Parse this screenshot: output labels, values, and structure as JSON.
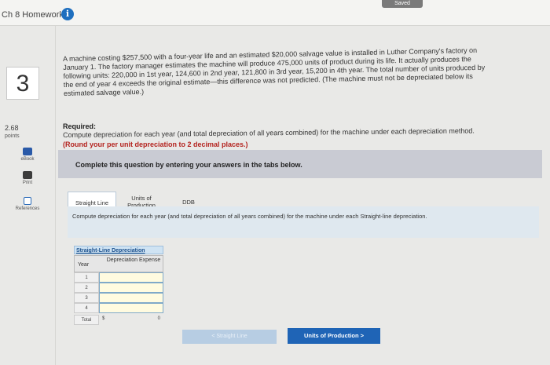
{
  "header": {
    "title": "Ch 8 Homework",
    "info_icon": "info-icon",
    "saved_label": "Saved"
  },
  "sidebar": {
    "question_number": "3",
    "points_value": "2.68",
    "points_label": "points",
    "tools": [
      {
        "label": "eBook",
        "icon": "ebook-icon"
      },
      {
        "label": "Print",
        "icon": "print-icon"
      },
      {
        "label": "References",
        "icon": "references-icon"
      }
    ]
  },
  "problem": {
    "line1": "A machine costing $257,500 with a four-year life and an estimated $20,000 salvage value is installed in Luther Company's factory on",
    "line2": "January 1. The factory manager estimates the machine will produce 475,000 units of product during its life. It actually produces the",
    "line3": "following units: 220,000 in 1st year, 124,600 in 2nd year, 121,800 in 3rd year, 15,200 in 4th year. The total number of units produced by",
    "line4": "the end of year 4 exceeds the original estimate—this difference was not predicted. (The machine must not be depreciated below its",
    "line5": "estimated salvage value.)"
  },
  "required": {
    "title": "Required:",
    "text": "Compute depreciation for each year (and total depreciation of all years combined) for the machine under each depreciation method.",
    "note": "(Round your per unit depreciation to 2 decimal places.)"
  },
  "instruction": "Complete this question by entering your answers in the tabs below.",
  "tabs": [
    {
      "label": "Straight Line"
    },
    {
      "label": "Units of Production"
    },
    {
      "label": "DDB"
    }
  ],
  "tab_panel_text": "Compute depreciation for each year (and total depreciation of all years combined) for the machine under each Straight-line depreciation.",
  "table": {
    "caption": "Straight-Line Depreciation",
    "col_year": "Year",
    "col_expense": "Depreciation Expense",
    "years": [
      "1",
      "2",
      "3",
      "4"
    ],
    "total_label": "Total",
    "total_currency": "$",
    "total_value": "0"
  },
  "nav": {
    "prev_label": "< Straight Line",
    "next_label": "Units of Production >"
  },
  "colors": {
    "accent": "#1f64b6",
    "required_note": "#b4231e"
  }
}
